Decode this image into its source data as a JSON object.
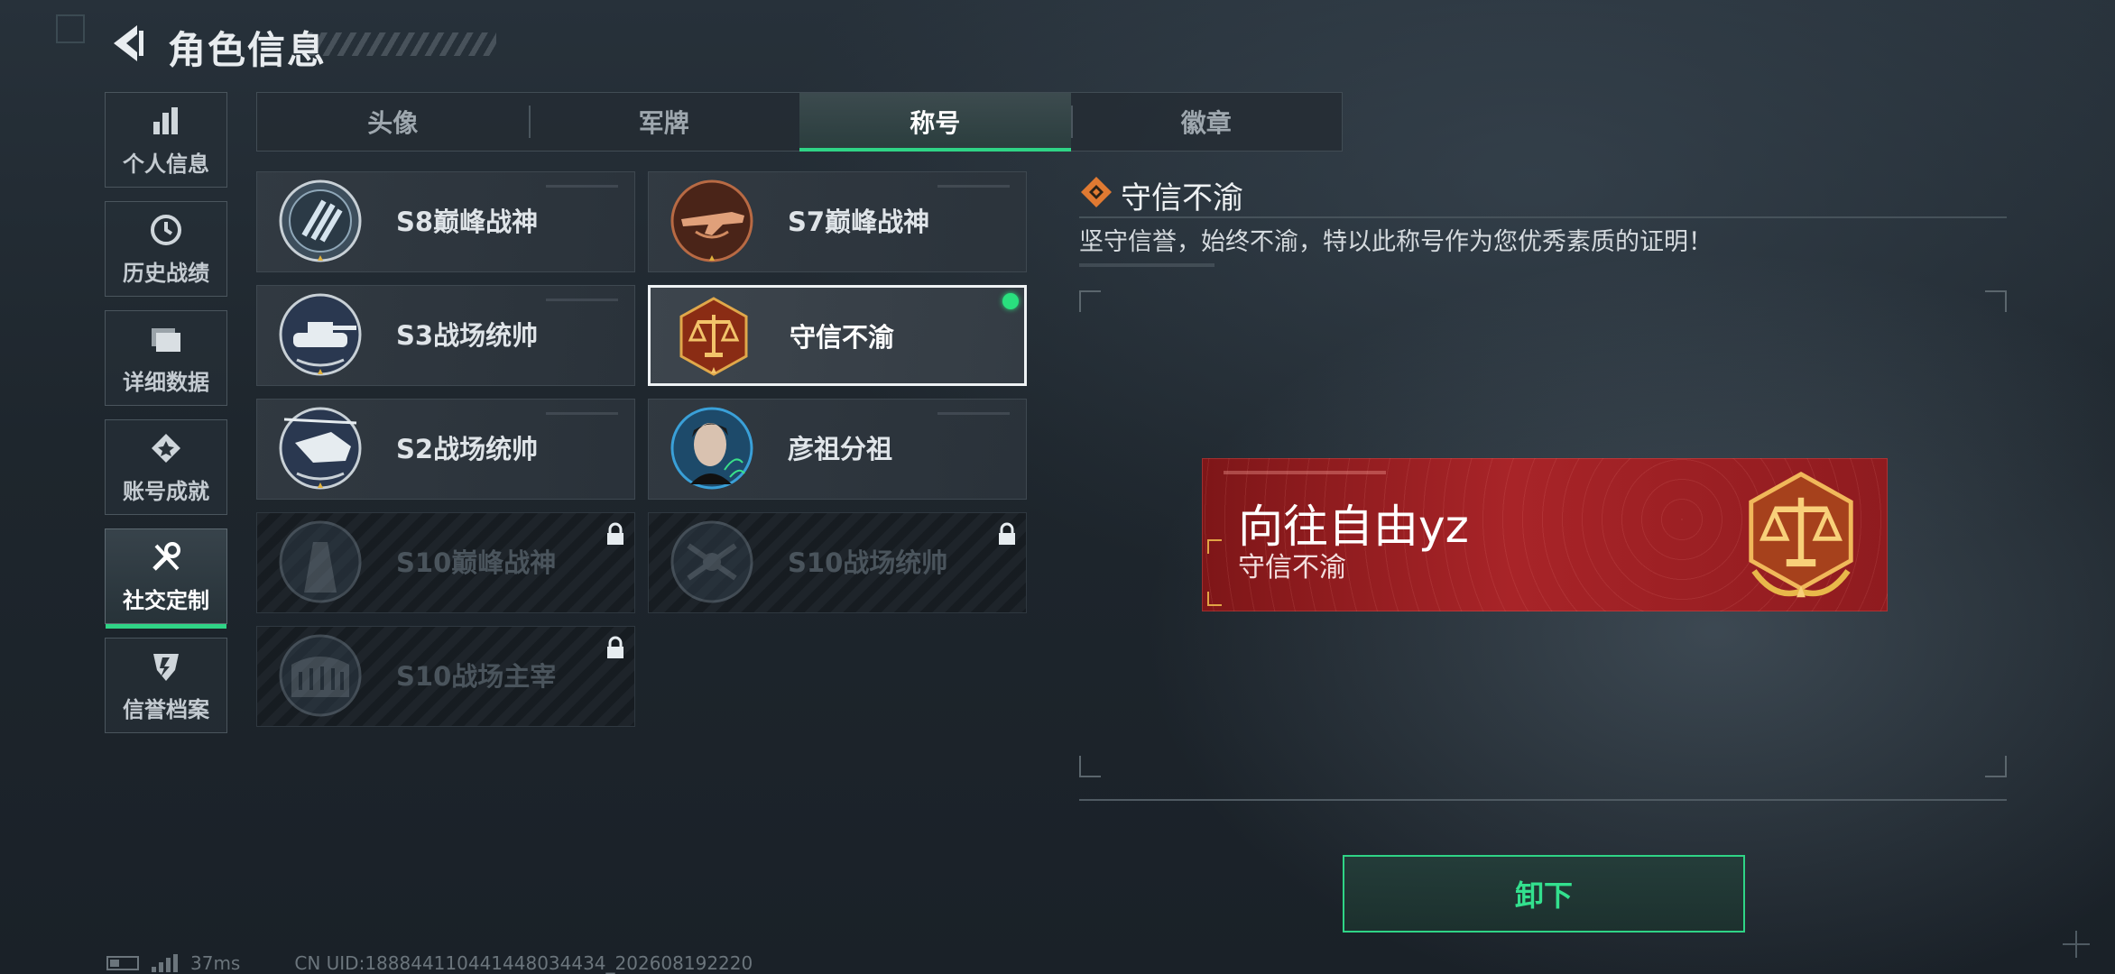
{
  "header": {
    "title": "角色信息"
  },
  "side_nav": {
    "items": [
      {
        "label": "个人信息",
        "icon": "bar-chart-icon"
      },
      {
        "label": "历史战绩",
        "icon": "history-clock-icon"
      },
      {
        "label": "详细数据",
        "icon": "folder-icon"
      },
      {
        "label": "账号成就",
        "icon": "achievement-medal-icon"
      },
      {
        "label": "社交定制",
        "icon": "wrench-screwdriver-icon",
        "active": true
      },
      {
        "label": "信誉档案",
        "icon": "credit-shield-icon"
      }
    ]
  },
  "tabs": [
    {
      "label": "头像"
    },
    {
      "label": "军牌"
    },
    {
      "label": "称号",
      "active": true
    },
    {
      "label": "徽章"
    }
  ],
  "titles": [
    {
      "name": "S8巅峰战神",
      "icon": "stripes-emblem-icon",
      "locked": false
    },
    {
      "name": "S7巅峰战神",
      "icon": "rifle-emblem-icon",
      "locked": false
    },
    {
      "name": "S3战场统帅",
      "icon": "tank-emblem-icon",
      "locked": false
    },
    {
      "name": "守信不渝",
      "icon": "scales-emblem-icon",
      "locked": false,
      "selected": true,
      "equipped": true
    },
    {
      "name": "S2战场统帅",
      "icon": "helicopter-emblem-icon",
      "locked": false
    },
    {
      "name": "彦祖分祖",
      "icon": "portrait-emblem-icon",
      "locked": false
    },
    {
      "name": "S10巅峰战神",
      "icon": "tower-emblem-icon",
      "locked": true
    },
    {
      "name": "S10战场统帅",
      "icon": "drone-emblem-icon",
      "locked": true
    },
    {
      "name": "S10战场主宰",
      "icon": "colosseum-emblem-icon",
      "locked": true
    }
  ],
  "detail": {
    "title": "守信不渝",
    "description": "坚守信誉，始终不渝，特以此称号作为您优秀素质的证明！"
  },
  "nameplate": {
    "player_name": "向往自由yz",
    "title": "守信不渝"
  },
  "actions": {
    "unequip_label": "卸下"
  },
  "status": {
    "ping": "37ms",
    "uid": "CN UID:188844110441448034434_202608192220"
  },
  "colors": {
    "accent_green": "#2fd486",
    "equipped_dot": "#29e07e",
    "nameplate_red": "#a82428",
    "emblem_bronze": "#c0602a"
  }
}
